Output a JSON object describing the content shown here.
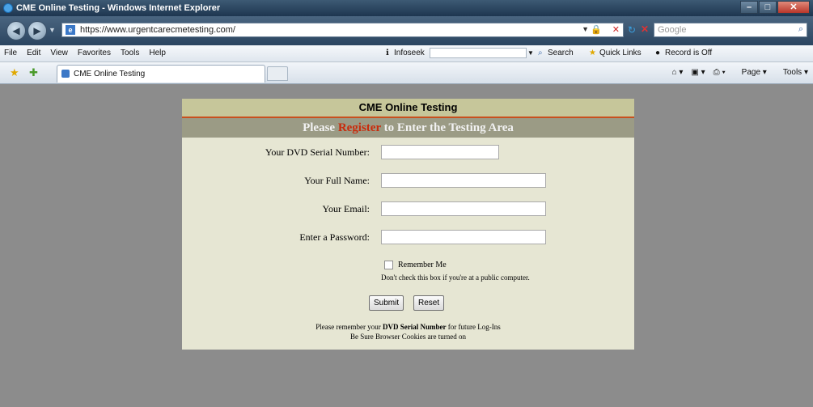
{
  "window": {
    "title": "CME Online Testing - Windows Internet Explorer",
    "buttons": [
      "–",
      "□",
      "✕"
    ]
  },
  "addressbar": {
    "url": "https://www.urgentcarecmetesting.com/",
    "search_placeholder": "Google"
  },
  "menubar": {
    "items": [
      "File",
      "Edit",
      "View",
      "Favorites",
      "Tools",
      "Help"
    ],
    "info_label": "Infoseek",
    "search_label": "Search",
    "quicklinks_label": "Quick Links",
    "record_label": "Record is Off"
  },
  "tabbar": {
    "tab_label": "CME Online Testing",
    "tools": [
      "Page",
      "Tools"
    ]
  },
  "panel": {
    "title": "CME Online Testing",
    "subtitle_prefix": "Please",
    "subtitle_link": "Register",
    "subtitle_suffix": "to Enter the Testing Area",
    "fields": [
      {
        "label": "Your DVD Serial Number:",
        "value": ""
      },
      {
        "label": "Your Full Name:",
        "value": ""
      },
      {
        "label": "Your Email:",
        "value": ""
      },
      {
        "label": "Enter a Password:",
        "value": ""
      }
    ],
    "remember_label": "Remember Me",
    "remember_note": "Don't check this box if you're at a public computer.",
    "submit_label": "Submit",
    "reset_label": "Reset",
    "note1_prefix": "Please remember your",
    "note1_bold": "DVD Serial Number",
    "note1_suffix": "for future Log-Ins",
    "note2": "Be Sure Browser Cookies are turned on"
  }
}
